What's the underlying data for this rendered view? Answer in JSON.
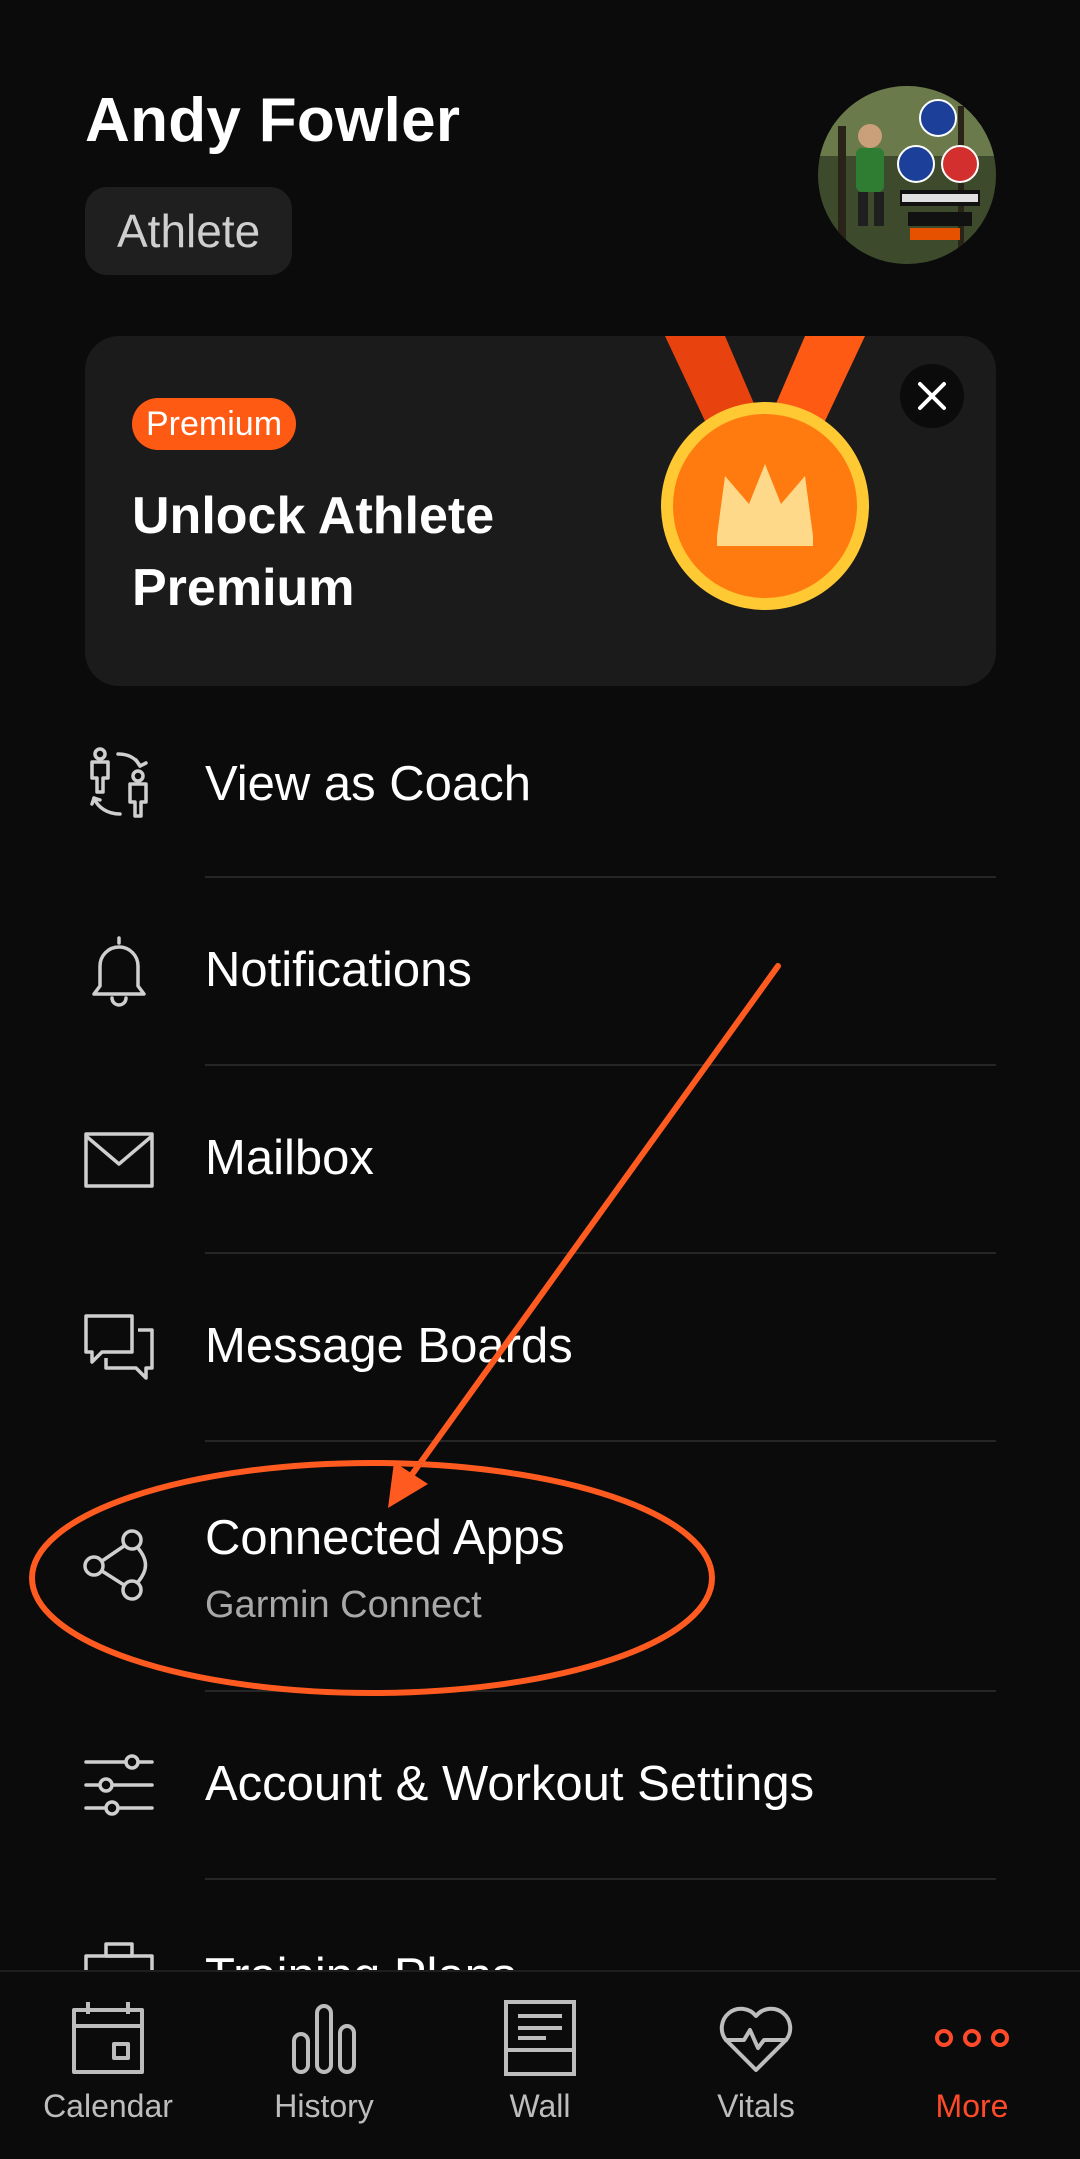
{
  "profile": {
    "name": "Andy Fowler",
    "role": "Athlete"
  },
  "premium_card": {
    "badge": "Premium",
    "title": "Unlock Athlete Premium",
    "accent_color": "#ff5a14"
  },
  "menu": [
    {
      "label": "View as Coach",
      "icon": "coach-switch-icon"
    },
    {
      "label": "Notifications",
      "icon": "bell-icon"
    },
    {
      "label": "Mailbox",
      "icon": "mail-icon"
    },
    {
      "label": "Message Boards",
      "icon": "chat-bubbles-icon"
    },
    {
      "label": "Connected Apps",
      "sublabel": "Garmin Connect",
      "icon": "connected-nodes-icon"
    },
    {
      "label": "Account & Workout Settings",
      "icon": "sliders-icon"
    },
    {
      "label": "Training Plans",
      "icon": "briefcase-icon"
    }
  ],
  "bottom_nav": [
    {
      "label": "Calendar",
      "icon": "calendar-icon",
      "active": false
    },
    {
      "label": "History",
      "icon": "bar-chart-icon",
      "active": false
    },
    {
      "label": "Wall",
      "icon": "wall-icon",
      "active": false
    },
    {
      "label": "Vitals",
      "icon": "heart-pulse-icon",
      "active": false
    },
    {
      "label": "More",
      "icon": "more-dots-icon",
      "active": true
    }
  ],
  "colors": {
    "background": "#0b0b0b",
    "accent": "#ff5a14",
    "active_nav": "#ff4a2a",
    "annotation": "#ff5a1f"
  }
}
